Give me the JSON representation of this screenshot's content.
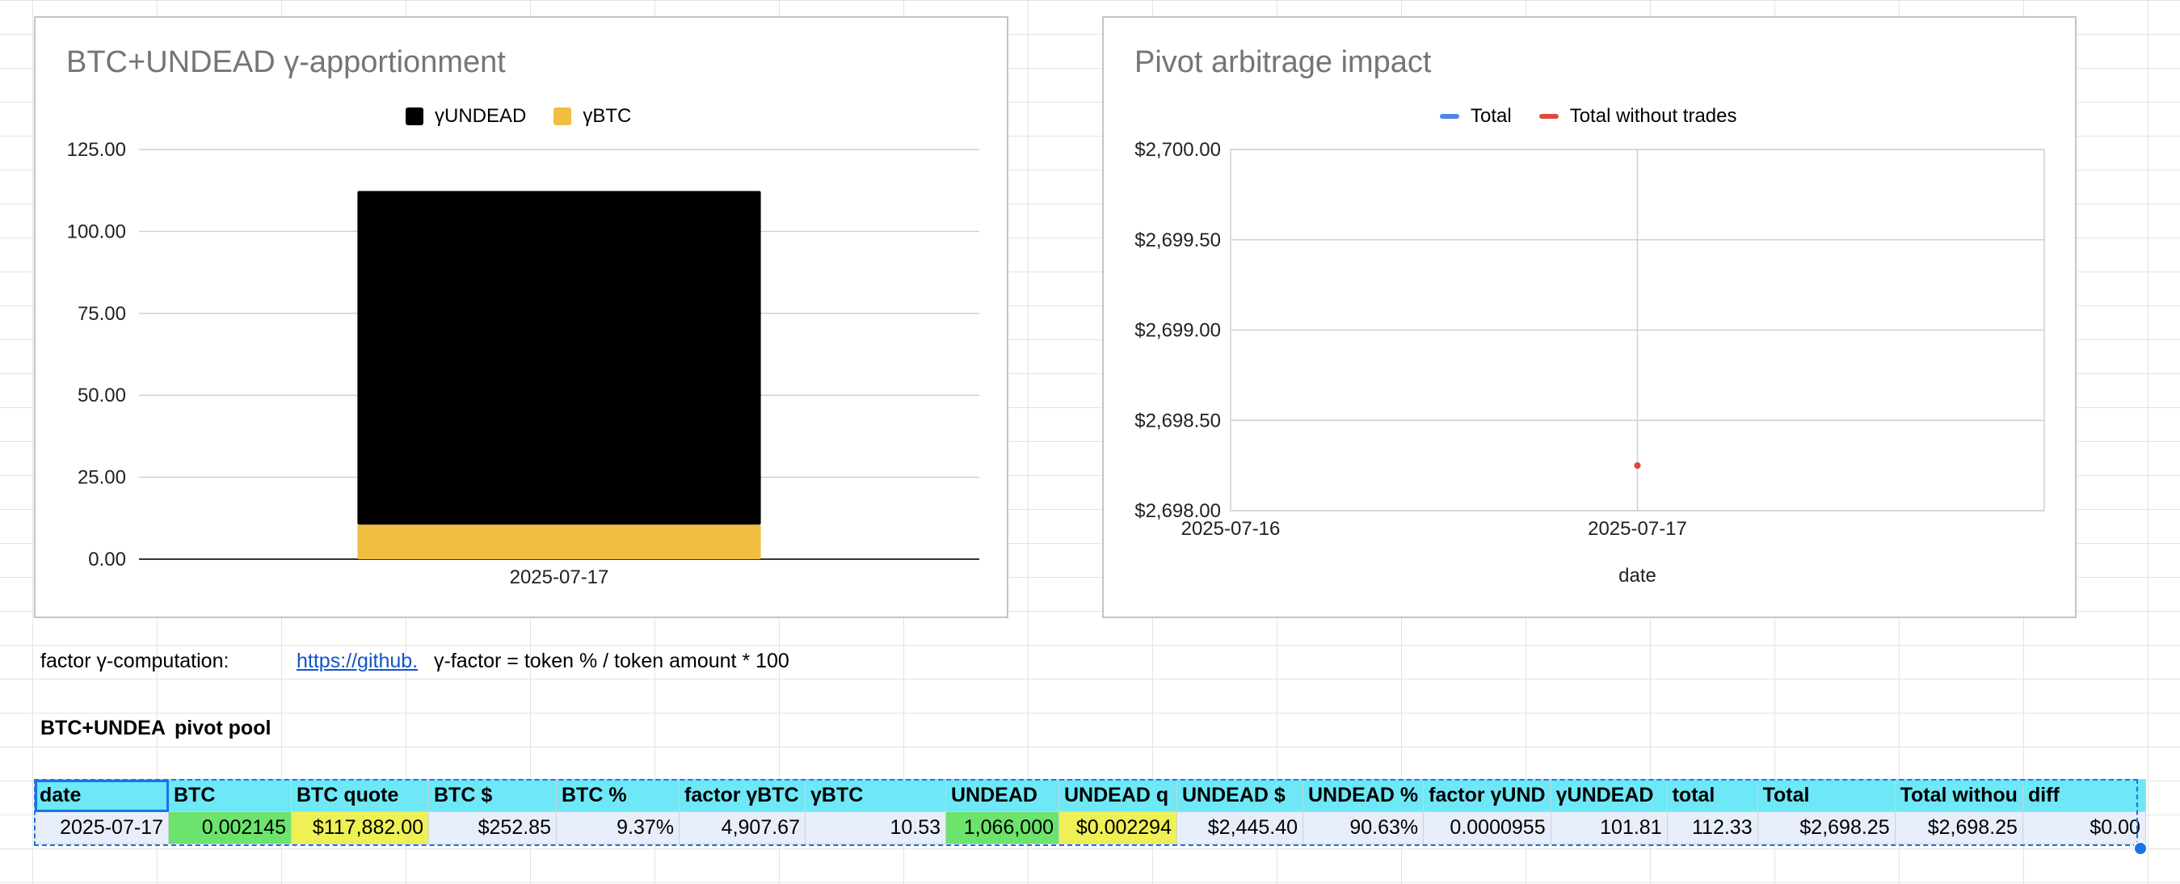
{
  "chart_data": [
    {
      "type": "bar",
      "stacked": true,
      "title": "BTC+UNDEAD γ-apportionment",
      "categories": [
        "2025-07-17"
      ],
      "series": [
        {
          "name": "γBTC",
          "color": "#f1be42",
          "values": [
            10.53
          ]
        },
        {
          "name": "γUNDEAD",
          "color": "#000000",
          "values": [
            101.81
          ]
        }
      ],
      "legend_order": [
        "γUNDEAD",
        "γBTC"
      ],
      "legend_position": "top",
      "ylim": [
        0,
        125
      ],
      "yticks": [
        {
          "value": 0,
          "label": "0.00"
        },
        {
          "value": 25,
          "label": "25.00"
        },
        {
          "value": 50,
          "label": "50.00"
        },
        {
          "value": 75,
          "label": "75.00"
        },
        {
          "value": 100,
          "label": "100.00"
        },
        {
          "value": 125,
          "label": "125.00"
        }
      ],
      "xlabel": "",
      "ylabel": "",
      "grid": true
    },
    {
      "type": "line",
      "title": "Pivot arbitrage impact",
      "xlabel": "date",
      "x_range": [
        "2025-07-16",
        "2025-07-18"
      ],
      "xticks": [
        "2025-07-16",
        "2025-07-17"
      ],
      "series": [
        {
          "name": "Total",
          "color": "#4f86e8",
          "points": [
            {
              "x": "2025-07-17",
              "y": 2698.25
            }
          ]
        },
        {
          "name": "Total without trades",
          "color": "#e0493b",
          "points": [
            {
              "x": "2025-07-17",
              "y": 2698.25
            }
          ]
        }
      ],
      "legend_position": "top",
      "ylim": [
        2698.0,
        2700.0
      ],
      "yticks": [
        {
          "value": 2698.0,
          "label": "$2,698.00"
        },
        {
          "value": 2698.5,
          "label": "$2,698.50"
        },
        {
          "value": 2699.0,
          "label": "$2,699.00"
        },
        {
          "value": 2699.5,
          "label": "$2,699.50"
        },
        {
          "value": 2700.0,
          "label": "$2,700.00"
        }
      ],
      "grid": true
    }
  ],
  "sheet": {
    "factor_label": "factor γ-computation:",
    "factor_link": "https://github.",
    "factor_formula": "γ-factor = token % / token amount * 100",
    "pool_title_a": "BTC+UNDEA",
    "pool_title_b": "pivot pool",
    "headers": [
      "date",
      "BTC",
      "BTC quote",
      "BTC $",
      "BTC %",
      "factor γBTC",
      "γBTC",
      "UNDEAD",
      "UNDEAD q",
      "UNDEAD $",
      "UNDEAD %",
      "factor γUND",
      "γUNDEAD",
      "total",
      "Total",
      "Total withou",
      "diff"
    ],
    "row": [
      "2025-07-17",
      "0.002145",
      "$117,882.00",
      "$252.85",
      "9.37%",
      "4,907.67",
      "10.53",
      "1,066,000",
      "$0.002294",
      "$2,445.40",
      "90.63%",
      "0.0000955",
      "101.81",
      "112.33",
      "$2,698.25",
      "$2,698.25",
      "$0.00"
    ],
    "highlight_colors": {
      "header": "#6ee8f6",
      "green": "#6ce36c",
      "yellow": "#eef055",
      "row": "#e7eef9"
    }
  }
}
